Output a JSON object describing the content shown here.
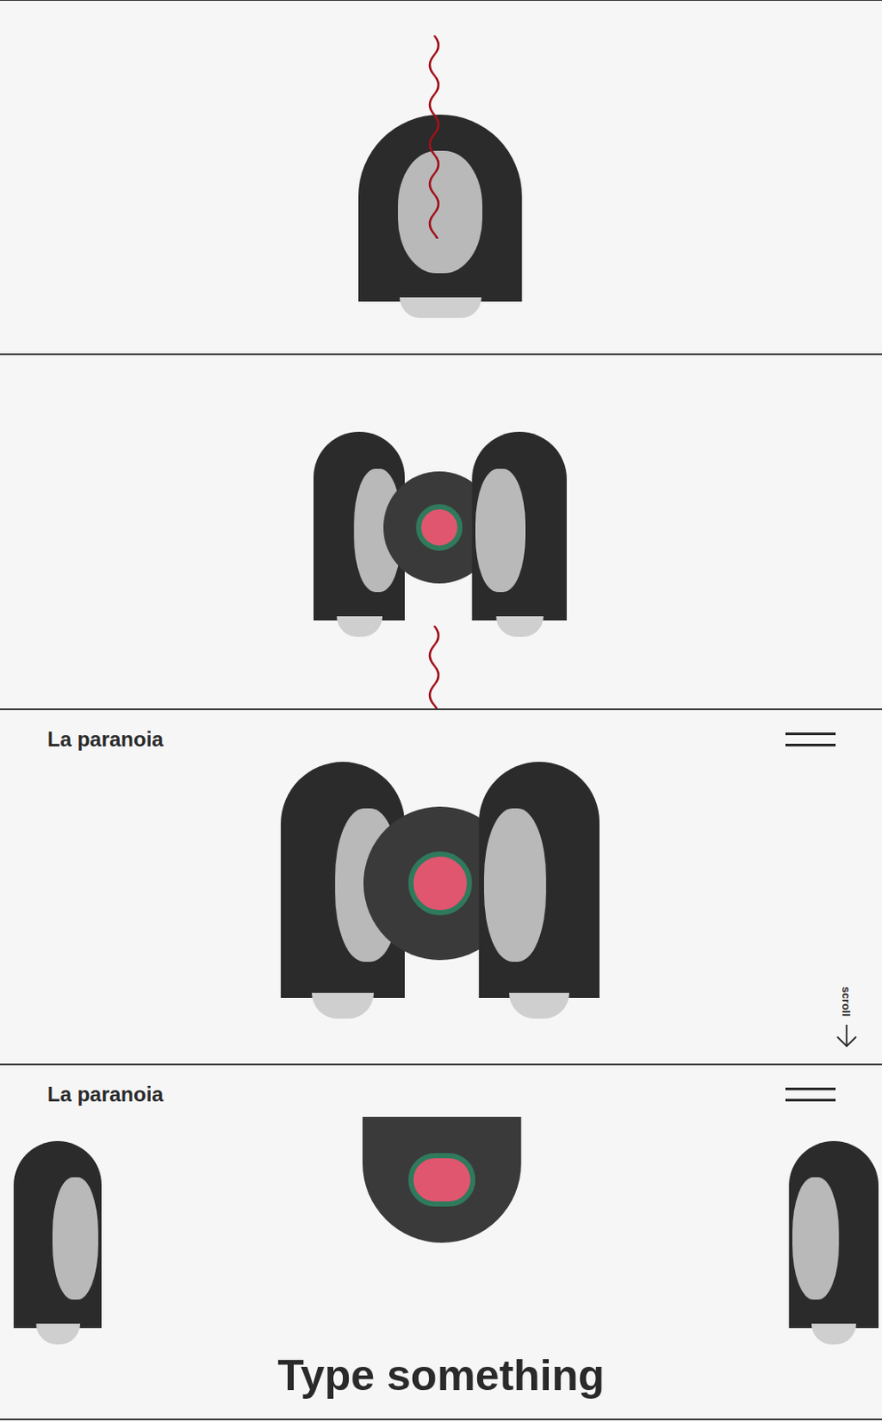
{
  "frames": [
    {
      "kind": "single-face"
    },
    {
      "kind": "open-faces"
    },
    {
      "kind": "header-view",
      "brand": "La paranoia",
      "scroll_label": "scroll"
    },
    {
      "kind": "type-view",
      "brand": "La paranoia",
      "headline": "Type something"
    }
  ]
}
